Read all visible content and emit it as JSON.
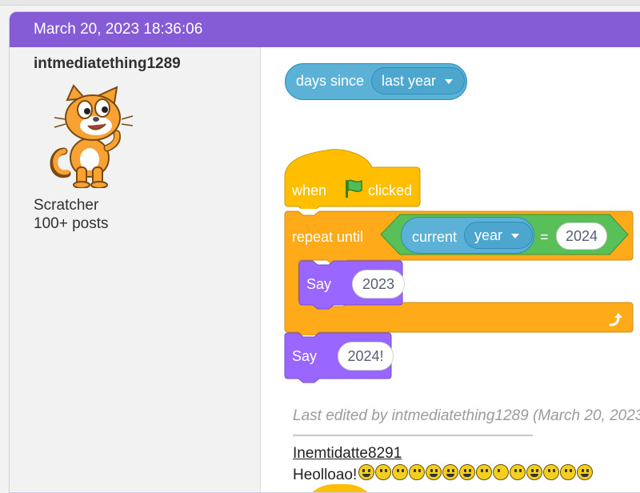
{
  "post": {
    "timestamp": "March 20, 2023 18:36:06",
    "author": {
      "username": "intmediatething1289",
      "rank": "Scratcher",
      "post_count": "100+ posts"
    },
    "script": {
      "reporter_days_since": {
        "label": "days since",
        "dropdown": "last year"
      },
      "hat": {
        "when": "when",
        "clicked": "clicked"
      },
      "repeat": {
        "label": "repeat until",
        "current": "current",
        "current_dropdown": "year",
        "equals": "=",
        "value": "2024"
      },
      "inner_say": {
        "label": "Say",
        "value": "2023"
      },
      "after_say": {
        "label": "Say",
        "value": "2024!"
      }
    },
    "edit_note": "Last edited by intmediatething1289 (March 20, 2023",
    "signature": {
      "name": "Inemtidatte8291",
      "text": "Heolloao!"
    }
  },
  "colors": {
    "header": "#855cd6",
    "events": "#ffbf00",
    "control": "#ffab19",
    "looks": "#9966ff",
    "sensing": "#5cb1d6",
    "operators": "#59c059"
  },
  "icons": {
    "flag": "green-flag-icon",
    "loop_arrow": "loop-arrow-icon",
    "dropdown": "caret-down-icon"
  }
}
